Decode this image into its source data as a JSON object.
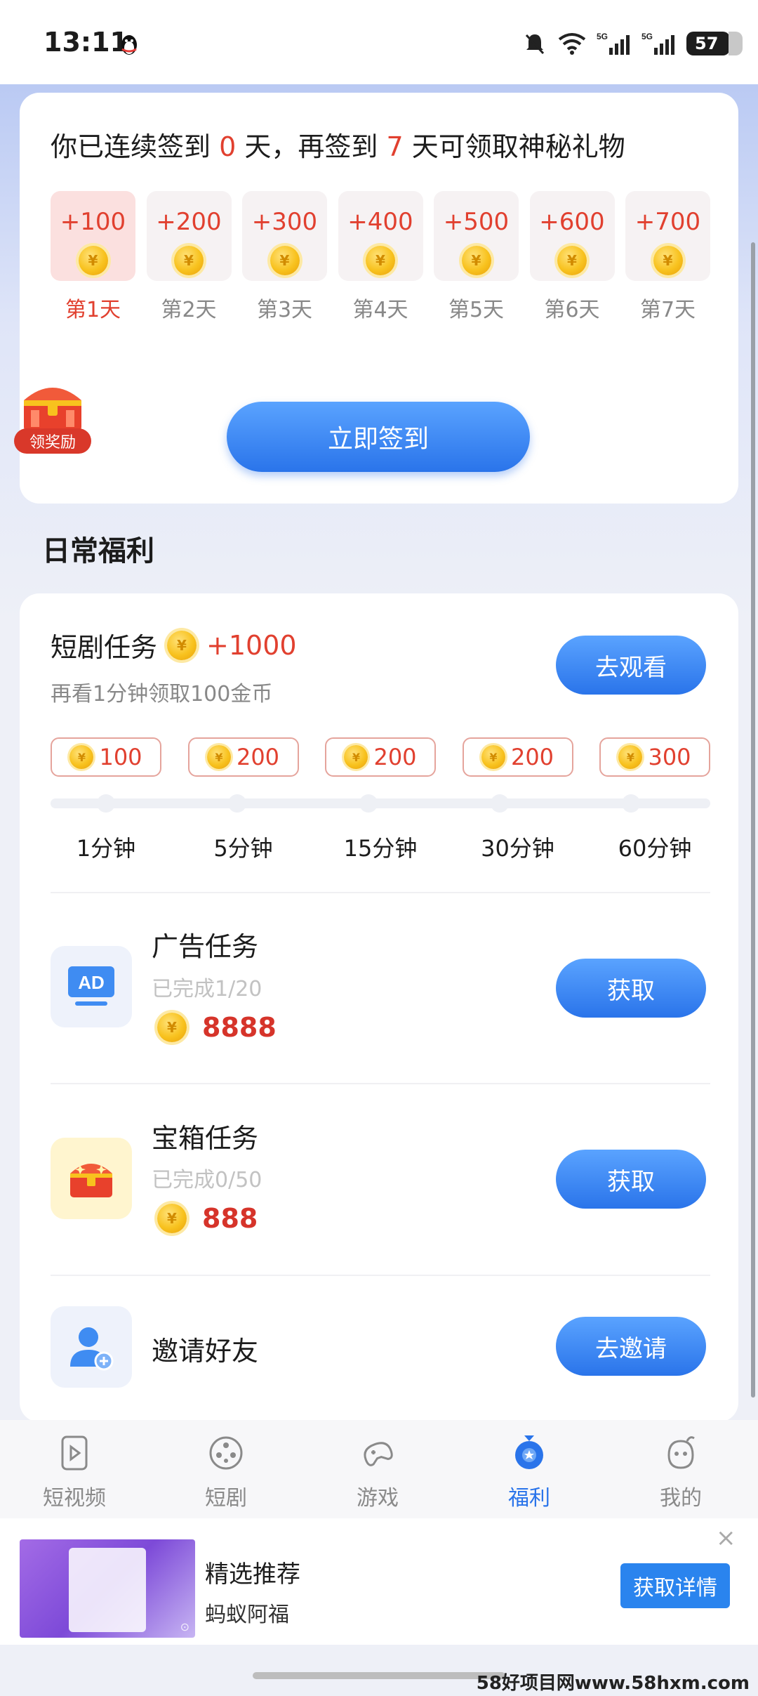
{
  "status_bar": {
    "time": "13:11",
    "battery": "57"
  },
  "signin": {
    "title_prefix": "你已连续签到",
    "streak_days": "0",
    "title_mid": "天，再签到",
    "remaining_days": "7",
    "title_suffix": "天可领取神秘礼物",
    "days": [
      {
        "points": "+100",
        "label": "第1天"
      },
      {
        "points": "+200",
        "label": "第2天"
      },
      {
        "points": "+300",
        "label": "第3天"
      },
      {
        "points": "+400",
        "label": "第4天"
      },
      {
        "points": "+500",
        "label": "第5天"
      },
      {
        "points": "+600",
        "label": "第6天"
      },
      {
        "points": "+700",
        "label": "第7天"
      }
    ],
    "button_label": "立即签到",
    "reward_badge": "领奖励"
  },
  "daily": {
    "section_title": "日常福利",
    "drama_task": {
      "title": "短剧任务",
      "points": "+1000",
      "subtitle": "再看1分钟领取100金币",
      "button_label": "去观看",
      "milestones": [
        {
          "reward": "100",
          "time": "1分钟"
        },
        {
          "reward": "200",
          "time": "5分钟"
        },
        {
          "reward": "200",
          "time": "15分钟"
        },
        {
          "reward": "200",
          "time": "30分钟"
        },
        {
          "reward": "300",
          "time": "60分钟"
        }
      ]
    },
    "ad_task": {
      "title": "广告任务",
      "progress": "已完成1/20",
      "reward": "8888",
      "button_label": "获取",
      "icon_text": "AD"
    },
    "chest_task": {
      "title": "宝箱任务",
      "progress": "已完成0/50",
      "reward": "888",
      "button_label": "获取"
    },
    "invite_task": {
      "title": "邀请好友",
      "button_label": "去邀请"
    }
  },
  "tabbar": {
    "items": [
      {
        "label": "短视频",
        "icon": "video-icon"
      },
      {
        "label": "短剧",
        "icon": "film-reel-icon"
      },
      {
        "label": "游戏",
        "icon": "gamepad-icon"
      },
      {
        "label": "福利",
        "icon": "gift-medal-icon"
      },
      {
        "label": "我的",
        "icon": "profile-face-icon"
      }
    ],
    "active_index": 3
  },
  "ad_banner": {
    "title": "精选推荐",
    "brand": "蚂蚁阿福",
    "button_label": "获取详情",
    "close": "×"
  },
  "watermark": "58好项目网www.58hxm.com",
  "colors": {
    "accent_blue": "#2a74ea",
    "points_red": "#e1402f",
    "coin_gold": "#f8c21e"
  }
}
